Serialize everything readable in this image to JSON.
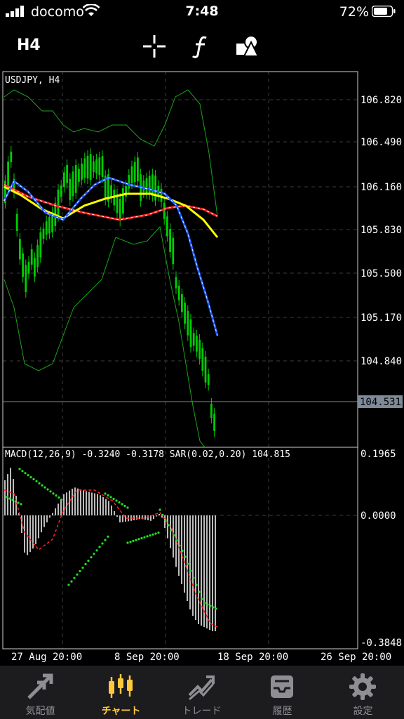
{
  "status": {
    "carrier": "docomo",
    "time": "7:48",
    "battery": "72%"
  },
  "toolbar": {
    "timeframe": "H4",
    "icons": [
      "crosshair-icon",
      "function-icon",
      "objects-icon"
    ]
  },
  "chart": {
    "symbol_label": "USDJPY, H4",
    "price_ticks": [
      "106.820",
      "106.490",
      "106.160",
      "105.830",
      "105.500",
      "105.170",
      "104.840"
    ],
    "current_price": "104.531",
    "indicator_label": "MACD(12,26,9) -0.3240 -0.3178 SAR(0.02,0.20) 104.815",
    "macd_ticks": [
      "0.1965",
      "0.0000",
      "-0.3848"
    ],
    "date_ticks": [
      "27 Aug 20:00",
      "8 Sep 20:00",
      "18 Sep 20:00",
      "26 Sep 20:00"
    ],
    "colors": {
      "candle": "#00cc00",
      "ma_blue": "#1e5bff",
      "ma_yellow": "#ffff00",
      "ma_red": "#ff2020",
      "bands": "#1aa31a",
      "grid": "#3c3c3c"
    }
  },
  "tabs": [
    {
      "label": "気配値",
      "icon": "quotes-arrows-icon"
    },
    {
      "label": "チャート",
      "icon": "candlestick-chart-icon"
    },
    {
      "label": "トレード",
      "icon": "trade-trend-icon"
    },
    {
      "label": "履歴",
      "icon": "history-tray-icon"
    },
    {
      "label": "設定",
      "icon": "settings-gear-icon"
    }
  ]
}
